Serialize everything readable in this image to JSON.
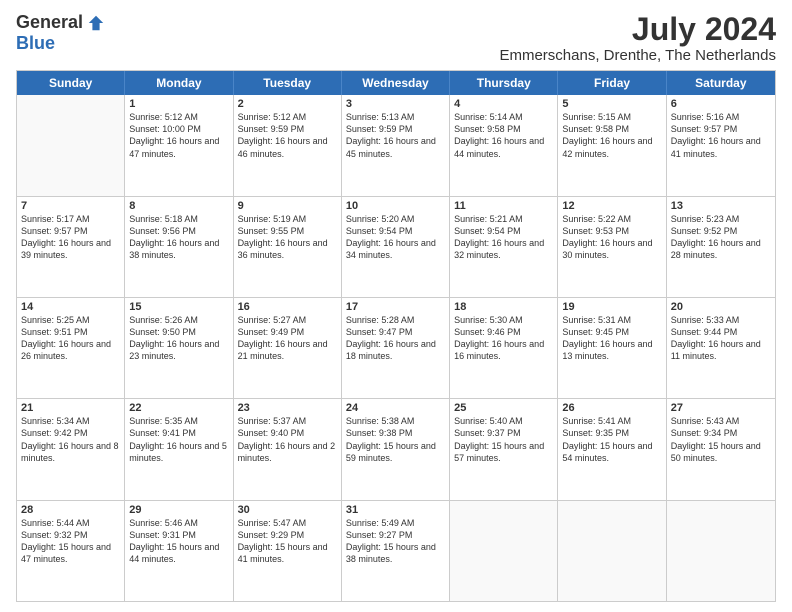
{
  "logo": {
    "general": "General",
    "blue": "Blue"
  },
  "title": "July 2024",
  "subtitle": "Emmerschans, Drenthe, The Netherlands",
  "header_days": [
    "Sunday",
    "Monday",
    "Tuesday",
    "Wednesday",
    "Thursday",
    "Friday",
    "Saturday"
  ],
  "weeks": [
    [
      {
        "day": "",
        "sunrise": "",
        "sunset": "",
        "daylight": ""
      },
      {
        "day": "1",
        "sunrise": "Sunrise: 5:12 AM",
        "sunset": "Sunset: 10:00 PM",
        "daylight": "Daylight: 16 hours and 47 minutes."
      },
      {
        "day": "2",
        "sunrise": "Sunrise: 5:12 AM",
        "sunset": "Sunset: 9:59 PM",
        "daylight": "Daylight: 16 hours and 46 minutes."
      },
      {
        "day": "3",
        "sunrise": "Sunrise: 5:13 AM",
        "sunset": "Sunset: 9:59 PM",
        "daylight": "Daylight: 16 hours and 45 minutes."
      },
      {
        "day": "4",
        "sunrise": "Sunrise: 5:14 AM",
        "sunset": "Sunset: 9:58 PM",
        "daylight": "Daylight: 16 hours and 44 minutes."
      },
      {
        "day": "5",
        "sunrise": "Sunrise: 5:15 AM",
        "sunset": "Sunset: 9:58 PM",
        "daylight": "Daylight: 16 hours and 42 minutes."
      },
      {
        "day": "6",
        "sunrise": "Sunrise: 5:16 AM",
        "sunset": "Sunset: 9:57 PM",
        "daylight": "Daylight: 16 hours and 41 minutes."
      }
    ],
    [
      {
        "day": "7",
        "sunrise": "Sunrise: 5:17 AM",
        "sunset": "Sunset: 9:57 PM",
        "daylight": "Daylight: 16 hours and 39 minutes."
      },
      {
        "day": "8",
        "sunrise": "Sunrise: 5:18 AM",
        "sunset": "Sunset: 9:56 PM",
        "daylight": "Daylight: 16 hours and 38 minutes."
      },
      {
        "day": "9",
        "sunrise": "Sunrise: 5:19 AM",
        "sunset": "Sunset: 9:55 PM",
        "daylight": "Daylight: 16 hours and 36 minutes."
      },
      {
        "day": "10",
        "sunrise": "Sunrise: 5:20 AM",
        "sunset": "Sunset: 9:54 PM",
        "daylight": "Daylight: 16 hours and 34 minutes."
      },
      {
        "day": "11",
        "sunrise": "Sunrise: 5:21 AM",
        "sunset": "Sunset: 9:54 PM",
        "daylight": "Daylight: 16 hours and 32 minutes."
      },
      {
        "day": "12",
        "sunrise": "Sunrise: 5:22 AM",
        "sunset": "Sunset: 9:53 PM",
        "daylight": "Daylight: 16 hours and 30 minutes."
      },
      {
        "day": "13",
        "sunrise": "Sunrise: 5:23 AM",
        "sunset": "Sunset: 9:52 PM",
        "daylight": "Daylight: 16 hours and 28 minutes."
      }
    ],
    [
      {
        "day": "14",
        "sunrise": "Sunrise: 5:25 AM",
        "sunset": "Sunset: 9:51 PM",
        "daylight": "Daylight: 16 hours and 26 minutes."
      },
      {
        "day": "15",
        "sunrise": "Sunrise: 5:26 AM",
        "sunset": "Sunset: 9:50 PM",
        "daylight": "Daylight: 16 hours and 23 minutes."
      },
      {
        "day": "16",
        "sunrise": "Sunrise: 5:27 AM",
        "sunset": "Sunset: 9:49 PM",
        "daylight": "Daylight: 16 hours and 21 minutes."
      },
      {
        "day": "17",
        "sunrise": "Sunrise: 5:28 AM",
        "sunset": "Sunset: 9:47 PM",
        "daylight": "Daylight: 16 hours and 18 minutes."
      },
      {
        "day": "18",
        "sunrise": "Sunrise: 5:30 AM",
        "sunset": "Sunset: 9:46 PM",
        "daylight": "Daylight: 16 hours and 16 minutes."
      },
      {
        "day": "19",
        "sunrise": "Sunrise: 5:31 AM",
        "sunset": "Sunset: 9:45 PM",
        "daylight": "Daylight: 16 hours and 13 minutes."
      },
      {
        "day": "20",
        "sunrise": "Sunrise: 5:33 AM",
        "sunset": "Sunset: 9:44 PM",
        "daylight": "Daylight: 16 hours and 11 minutes."
      }
    ],
    [
      {
        "day": "21",
        "sunrise": "Sunrise: 5:34 AM",
        "sunset": "Sunset: 9:42 PM",
        "daylight": "Daylight: 16 hours and 8 minutes."
      },
      {
        "day": "22",
        "sunrise": "Sunrise: 5:35 AM",
        "sunset": "Sunset: 9:41 PM",
        "daylight": "Daylight: 16 hours and 5 minutes."
      },
      {
        "day": "23",
        "sunrise": "Sunrise: 5:37 AM",
        "sunset": "Sunset: 9:40 PM",
        "daylight": "Daylight: 16 hours and 2 minutes."
      },
      {
        "day": "24",
        "sunrise": "Sunrise: 5:38 AM",
        "sunset": "Sunset: 9:38 PM",
        "daylight": "Daylight: 15 hours and 59 minutes."
      },
      {
        "day": "25",
        "sunrise": "Sunrise: 5:40 AM",
        "sunset": "Sunset: 9:37 PM",
        "daylight": "Daylight: 15 hours and 57 minutes."
      },
      {
        "day": "26",
        "sunrise": "Sunrise: 5:41 AM",
        "sunset": "Sunset: 9:35 PM",
        "daylight": "Daylight: 15 hours and 54 minutes."
      },
      {
        "day": "27",
        "sunrise": "Sunrise: 5:43 AM",
        "sunset": "Sunset: 9:34 PM",
        "daylight": "Daylight: 15 hours and 50 minutes."
      }
    ],
    [
      {
        "day": "28",
        "sunrise": "Sunrise: 5:44 AM",
        "sunset": "Sunset: 9:32 PM",
        "daylight": "Daylight: 15 hours and 47 minutes."
      },
      {
        "day": "29",
        "sunrise": "Sunrise: 5:46 AM",
        "sunset": "Sunset: 9:31 PM",
        "daylight": "Daylight: 15 hours and 44 minutes."
      },
      {
        "day": "30",
        "sunrise": "Sunrise: 5:47 AM",
        "sunset": "Sunset: 9:29 PM",
        "daylight": "Daylight: 15 hours and 41 minutes."
      },
      {
        "day": "31",
        "sunrise": "Sunrise: 5:49 AM",
        "sunset": "Sunset: 9:27 PM",
        "daylight": "Daylight: 15 hours and 38 minutes."
      },
      {
        "day": "",
        "sunrise": "",
        "sunset": "",
        "daylight": ""
      },
      {
        "day": "",
        "sunrise": "",
        "sunset": "",
        "daylight": ""
      },
      {
        "day": "",
        "sunrise": "",
        "sunset": "",
        "daylight": ""
      }
    ]
  ]
}
